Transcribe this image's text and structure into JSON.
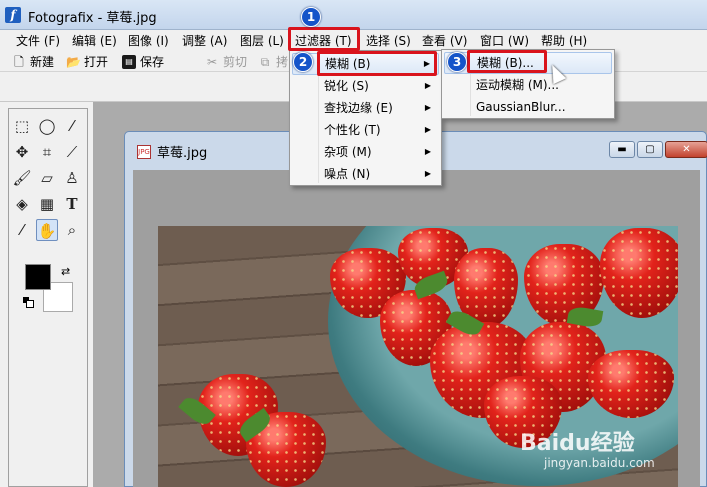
{
  "window": {
    "title": "Fotografix - 草莓.jpg"
  },
  "menubar": [
    {
      "id": "file",
      "label": "文件 (F)"
    },
    {
      "id": "edit",
      "label": "编辑 (E)"
    },
    {
      "id": "image",
      "label": "图像 (I)"
    },
    {
      "id": "adjust",
      "label": "调整 (A)"
    },
    {
      "id": "layer",
      "label": "图层 (L)"
    },
    {
      "id": "filter",
      "label": "过滤器 (T)"
    },
    {
      "id": "select",
      "label": "选择 (S)"
    },
    {
      "id": "view",
      "label": "查看 (V)"
    },
    {
      "id": "window",
      "label": "窗口 (W)"
    },
    {
      "id": "help",
      "label": "帮助 (H)"
    }
  ],
  "toolbar": {
    "new": "新建",
    "open": "打开",
    "save": "保存",
    "cut": "剪切",
    "copy": "拷"
  },
  "document": {
    "title": "草莓.jpg",
    "icon_text": "JPG"
  },
  "filter_menu": [
    {
      "label": "模糊 (B)",
      "highlighted": true
    },
    {
      "label": "锐化 (S)"
    },
    {
      "label": "查找边缘 (E)"
    },
    {
      "label": "个性化 (T)"
    },
    {
      "label": "杂项 (M)"
    },
    {
      "label": "噪点 (N)"
    }
  ],
  "blur_submenu": [
    {
      "label": "模糊 (B)...",
      "highlighted": true
    },
    {
      "label": "运动模糊 (M)..."
    },
    {
      "label": "GaussianBlur..."
    }
  ],
  "steps": [
    "1",
    "2",
    "3"
  ],
  "colors": {
    "highlight_box": "#d9141d",
    "step_marker": "#1554c9",
    "foreground": "#000000",
    "background": "#ffffff"
  },
  "watermark": {
    "brand": "Baidu经验",
    "url": "jingyan.baidu.com"
  }
}
